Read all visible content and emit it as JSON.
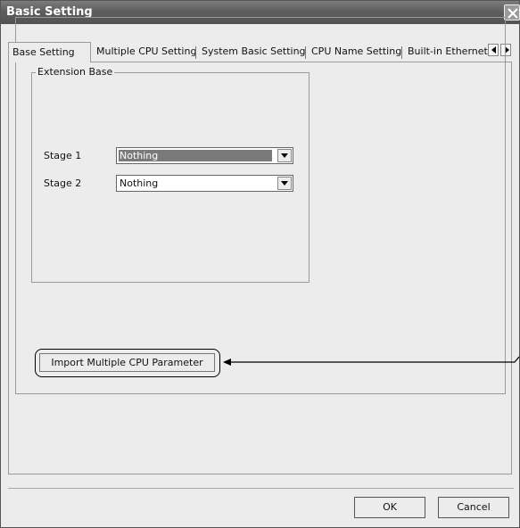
{
  "window": {
    "title": "Basic Setting"
  },
  "tabs": [
    {
      "label": "Base Setting",
      "active": true
    },
    {
      "label": "Multiple CPU Setting"
    },
    {
      "label": "System Basic Setting"
    },
    {
      "label": "CPU Name Setting"
    },
    {
      "label": "Built-in Ethernet"
    }
  ],
  "tab_scroll": {
    "left_icon": "arrow-left-icon",
    "right_icon": "arrow-right-icon"
  },
  "extension_base": {
    "legend": "Extension Base",
    "stages": [
      {
        "label": "Stage 1",
        "value": "Nothing",
        "selected": true
      },
      {
        "label": "Stage 2",
        "value": "Nothing",
        "selected": false
      }
    ]
  },
  "import_button_label": "Import Multiple CPU Parameter",
  "footer": {
    "ok_label": "OK",
    "cancel_label": "Cancel"
  },
  "colors": {
    "titlebar": "#5e5e5e",
    "dialog_bg": "#ececec",
    "selection": "#7a7a7a"
  }
}
